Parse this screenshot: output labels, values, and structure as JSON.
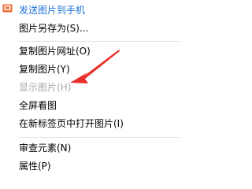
{
  "menu": {
    "items": [
      {
        "label": "发送图片到手机"
      },
      {
        "label": "图片另存为(S)..."
      },
      {
        "label": "复制图片网址(O)"
      },
      {
        "label": "复制图片(Y)"
      },
      {
        "label": "显示图片(H)"
      },
      {
        "label": "全屏看图"
      },
      {
        "label": "在新标签页中打开图片(I)"
      },
      {
        "label": "审查元素(N)"
      },
      {
        "label": "属性(P)"
      }
    ]
  },
  "colors": {
    "accent": "#1f73d6",
    "disabled": "#a8a8a8",
    "annotation_arrow": "#e8302c",
    "icon": "#f26a2e"
  },
  "icons": {
    "send_to_phone": "phone-send-icon",
    "annotation": "red-arrow-annotation"
  }
}
